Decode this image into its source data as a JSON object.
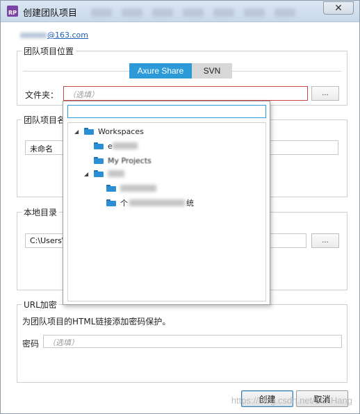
{
  "window": {
    "app_icon": "RP",
    "title": "创建团队项目",
    "close_glyph": "✕"
  },
  "account": {
    "suffix": "@163.com"
  },
  "location_group": {
    "legend": "团队项目位置",
    "tabs": [
      {
        "label": "Axure Share",
        "selected": true
      },
      {
        "label": "SVN",
        "selected": false
      }
    ],
    "folder_label": "文件夹：",
    "folder_placeholder": "（选填）",
    "browse_label": "..."
  },
  "name_group": {
    "legend": "团队项目名",
    "value": "未命名"
  },
  "local_group": {
    "legend": "本地目录",
    "value": "C:\\Users\\A",
    "browse_label": "..."
  },
  "url_group": {
    "legend": "URL加密",
    "description": "为团队项目的HTML链接添加密码保护。",
    "password_label": "密码",
    "password_placeholder": "（选填）"
  },
  "buttons": {
    "create": "创建",
    "cancel": "取消"
  },
  "watermark": "https://blog.csdn.net/SunHang",
  "folder_tree": {
    "search_value": "",
    "nodes": [
      {
        "label": "Workspaces",
        "expanded": true
      },
      {
        "label": "e"
      },
      {
        "label": "My Projects"
      },
      {
        "label": "",
        "expanded": true
      },
      {
        "label": ""
      },
      {
        "label": "个",
        "tail": "统"
      }
    ]
  },
  "icons": {
    "expanded": "expanded-triangle-icon",
    "folder": "folder-icon"
  },
  "colors": {
    "accent": "#2d9ad8",
    "segment_inactive": "#d7d7d7",
    "folder": "#2a8fd4",
    "link": "#1d5fb4",
    "focus_error": "#c44444"
  }
}
